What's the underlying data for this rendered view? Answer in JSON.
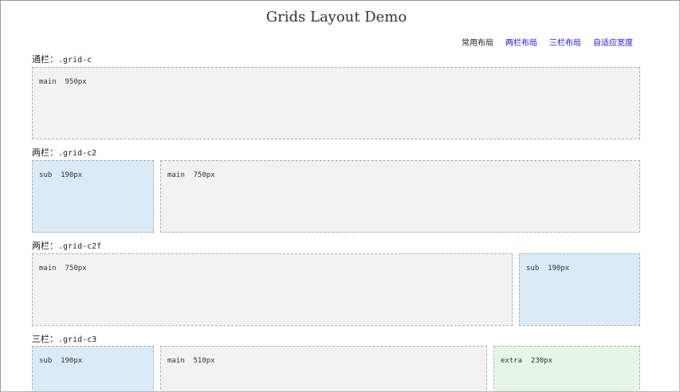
{
  "header": {
    "title": "Grids Layout Demo"
  },
  "nav": {
    "items": [
      {
        "label": "常用布局",
        "current": true
      },
      {
        "label": "两栏布局",
        "current": false
      },
      {
        "label": "三栏布局",
        "current": false
      },
      {
        "label": "自适应宽度",
        "current": false
      }
    ]
  },
  "sections": [
    {
      "label_cn": "通栏：",
      "label_code": ".grid-c",
      "boxes": [
        {
          "text": "main  950px",
          "color": "#f2f2f2"
        }
      ]
    },
    {
      "label_cn": "两栏：",
      "label_code": ".grid-c2",
      "boxes": [
        {
          "text": "sub  190px",
          "color": "#daeaf7"
        },
        {
          "text": "main  750px",
          "color": "#f2f2f2"
        }
      ]
    },
    {
      "label_cn": "两栏：",
      "label_code": ".grid-c2f",
      "boxes": [
        {
          "text": "main  750px",
          "color": "#f2f2f2"
        },
        {
          "text": "sub  190px",
          "color": "#daeaf7"
        }
      ]
    },
    {
      "label_cn": "三栏：",
      "label_code": ".grid-c3",
      "boxes": [
        {
          "text": "sub  190px",
          "color": "#daeaf7"
        },
        {
          "text": "main  510px",
          "color": "#f2f2f2"
        },
        {
          "text": "extra  230px",
          "color": "#e6f6e6"
        }
      ]
    }
  ],
  "colors": {
    "nav_link": "#1a1ad8",
    "main_bg": "#f2f2f2",
    "sub_bg": "#daeaf7",
    "extra_bg": "#e6f6e6",
    "dashed_border": "#b0b0b0"
  }
}
